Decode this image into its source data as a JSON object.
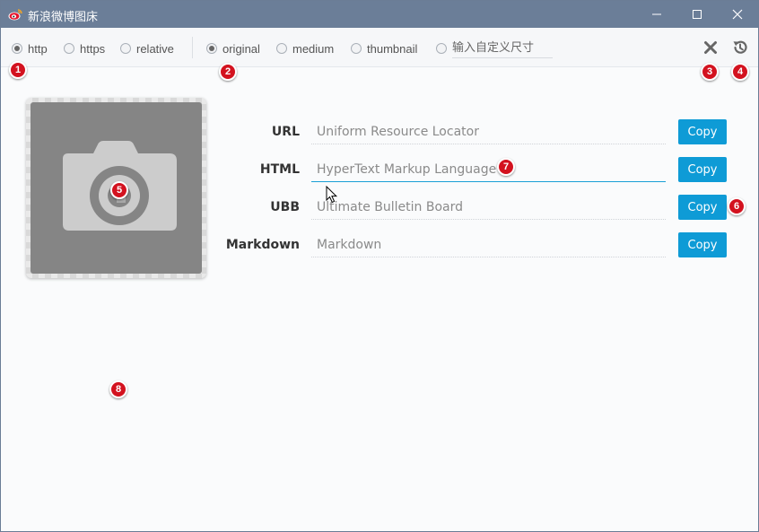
{
  "window": {
    "title": "新浪微博图床"
  },
  "protocol": {
    "options": [
      {
        "label": "http",
        "checked": true
      },
      {
        "label": "https",
        "checked": false
      },
      {
        "label": "relative",
        "checked": false
      }
    ]
  },
  "size": {
    "options": [
      {
        "label": "original",
        "checked": true
      },
      {
        "label": "medium",
        "checked": false
      },
      {
        "label": "thumbnail",
        "checked": false
      }
    ],
    "custom_placeholder": "输入自定义尺寸"
  },
  "toolbar_icons": {
    "clear": "close-x-icon",
    "history": "history-icon"
  },
  "badges": [
    "1",
    "2",
    "3",
    "4",
    "5",
    "6",
    "7",
    "8"
  ],
  "links": [
    {
      "label": "URL",
      "placeholder": "Uniform Resource Locator",
      "button": "Copy"
    },
    {
      "label": "HTML",
      "placeholder": "HyperText Markup Language",
      "button": "Copy"
    },
    {
      "label": "UBB",
      "placeholder": "Ultimate Bulletin Board",
      "button": "Copy"
    },
    {
      "label": "Markdown",
      "placeholder": "Markdown",
      "button": "Copy"
    }
  ],
  "colors": {
    "titlebar": "#6b7e98",
    "accent": "#0e9bd6",
    "badge": "#d3121f"
  }
}
